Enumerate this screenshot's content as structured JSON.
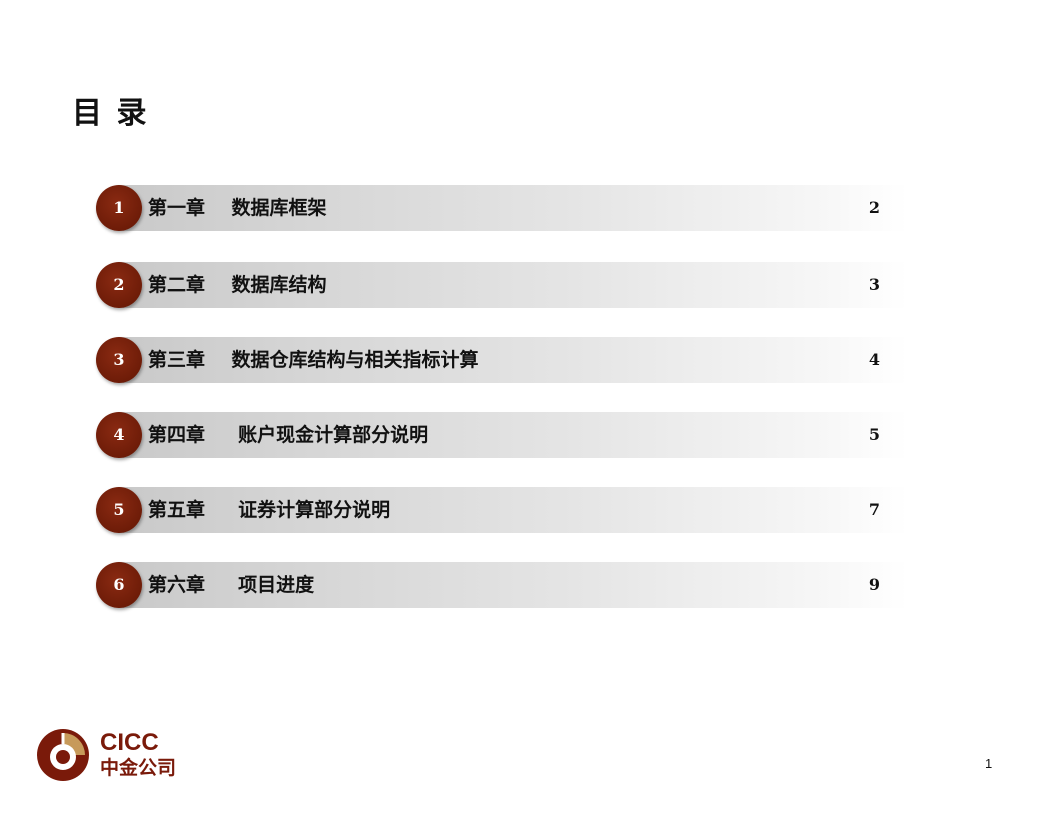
{
  "title": "目 录",
  "toc": [
    {
      "num": "1",
      "label": "第一章    数据库框架",
      "page": "2"
    },
    {
      "num": "2",
      "label": "第二章    数据库结构",
      "page": "3"
    },
    {
      "num": "3",
      "label": "第三章    数据仓库结构与相关指标计算",
      "page": "4"
    },
    {
      "num": "4",
      "label": "第四章     账户现金计算部分说明",
      "page": "5"
    },
    {
      "num": "5",
      "label": "第五章     证券计算部分说明",
      "page": "7"
    },
    {
      "num": "6",
      "label": "第六章     项目进度",
      "page": "9"
    }
  ],
  "logo": {
    "en": "CICC",
    "cn": "中金公司",
    "icon": "cicc-logo-icon"
  },
  "page_number": "1",
  "colors": {
    "accent": "#6e1c08",
    "logo_gold": "#c79a5a"
  }
}
